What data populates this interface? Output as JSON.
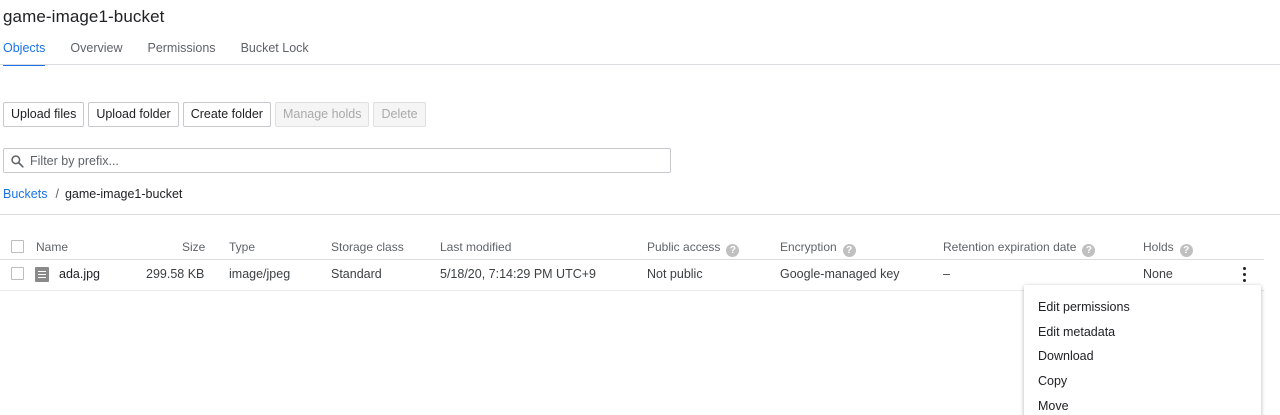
{
  "bucket_title": "game-image1-bucket",
  "tabs": [
    {
      "label": "Objects"
    },
    {
      "label": "Overview"
    },
    {
      "label": "Permissions"
    },
    {
      "label": "Bucket Lock"
    }
  ],
  "toolbar": {
    "upload_files": "Upload files",
    "upload_folder": "Upload folder",
    "create_folder": "Create folder",
    "manage_holds": "Manage holds",
    "delete": "Delete"
  },
  "filter": {
    "placeholder": "Filter by prefix..."
  },
  "breadcrumb": {
    "root": "Buckets",
    "separator": "/",
    "current": "game-image1-bucket"
  },
  "table": {
    "columns": {
      "name": "Name",
      "size": "Size",
      "type": "Type",
      "storage_class": "Storage class",
      "last_modified": "Last modified",
      "public_access": "Public access",
      "encryption": "Encryption",
      "retention": "Retention expiration date",
      "holds": "Holds"
    },
    "rows": [
      {
        "name": "ada.jpg",
        "size": "299.58 KB",
        "type": "image/jpeg",
        "storage_class": "Standard",
        "last_modified": "5/18/20, 7:14:29 PM UTC+9",
        "public_access": "Not public",
        "encryption": "Google-managed key",
        "retention": "–",
        "holds": "None"
      }
    ]
  },
  "context_menu": [
    {
      "label": "Edit permissions"
    },
    {
      "label": "Edit metadata"
    },
    {
      "label": "Download"
    },
    {
      "label": "Copy"
    },
    {
      "label": "Move"
    }
  ],
  "icons": {
    "search": "search-icon",
    "file": "file-icon",
    "help": "help-icon",
    "more": "more-vert-icon"
  },
  "colors": {
    "accent": "#1a73e8",
    "divider": "#dadce0",
    "disabled_text": "#aaaaaa"
  }
}
